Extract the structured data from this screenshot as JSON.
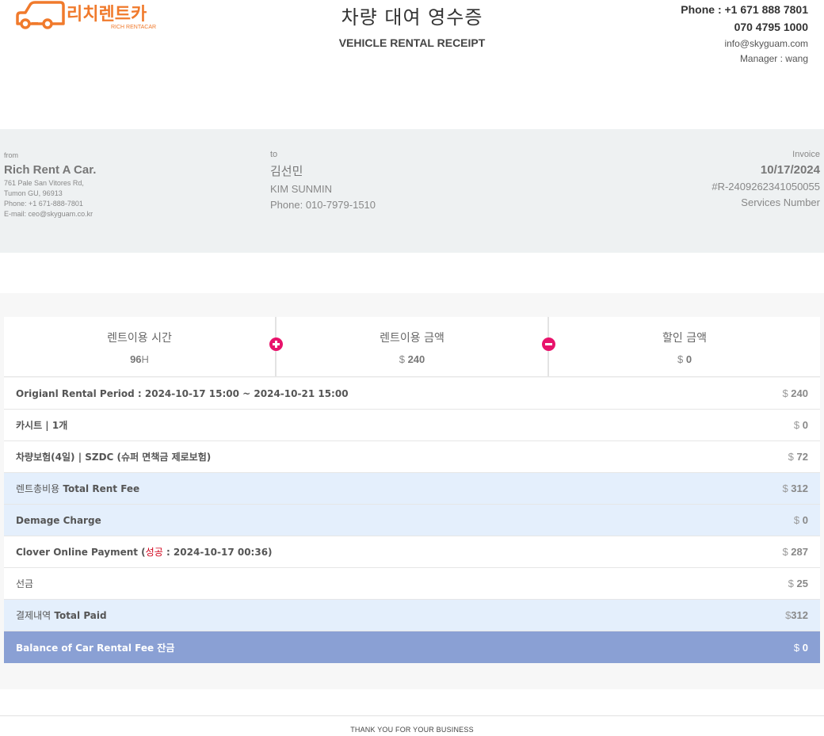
{
  "header": {
    "logo_text_kr": "리치렌트카",
    "logo_text_en": "RICH RENTACAR",
    "title_ko": "차량 대여 영수증",
    "title_en": "VEHICLE RENTAL RECEIPT",
    "phone1": "Phone : +1 671 888 7801",
    "phone2": "070 4795 1000",
    "email": "info@skyguam.com",
    "manager": "Manager : wang",
    "brand_color": "#f07a2c"
  },
  "from": {
    "label": "from",
    "name": "Rich Rent A Car.",
    "address1": "761 Pale San Vitores Rd,",
    "address2": "Tumon GU, 96913",
    "phone": "Phone: +1 671-888-7801",
    "email": "E-mail: ceo@skyguam.co.kr"
  },
  "to": {
    "label": "to",
    "name_kr": "김선민",
    "name_en": "KIM SUNMIN",
    "phone": "Phone: 010-7979-1510"
  },
  "invoice": {
    "label": "Invoice",
    "date": "10/17/2024",
    "number": "#R-2409262341050055",
    "services": "Services Number"
  },
  "summary": {
    "period_label": "렌트이용 시간",
    "period_value": "96",
    "period_unit": "H",
    "amount_label": "렌트이용 금액",
    "amount_currency": "$",
    "amount_value": "240",
    "discount_label": "할인 금액",
    "discount_currency": "$",
    "discount_value": "0",
    "accent_color": "#e8136b"
  },
  "items": [
    {
      "desc": "Origianl Rental Period : 2024-10-17 15:00 ~ 2024-10-21 15:00",
      "currency": "$",
      "amount": "240"
    },
    {
      "desc": "카시트 | 1개",
      "currency": "$",
      "amount": "0"
    },
    {
      "desc": "차량보험(4일) | SZDC (슈퍼 면책금 제로보험)",
      "currency": "$",
      "amount": "72"
    },
    {
      "desc_kr": "렌트총비용",
      "desc": "Total Rent Fee",
      "currency": "$",
      "amount": "312"
    },
    {
      "desc": "Demage Charge",
      "currency": "$",
      "amount": "0"
    },
    {
      "desc_pre": "Clover Online Payment (",
      "desc_status": "성공",
      "desc_post": " : 2024-10-17 00:36)",
      "currency": "$",
      "amount": "287"
    },
    {
      "desc_kr": "선금",
      "currency": "$",
      "amount": "25"
    },
    {
      "desc_kr": "결제내역",
      "desc": "Total Paid",
      "currency": "$",
      "amount": "312"
    },
    {
      "desc_pre": "Balance of Car Rental Fee ",
      "desc_kr": "잔금",
      "currency": "$",
      "amount": "0"
    }
  ],
  "footer": "THANK YOU FOR YOUR BUSINESS"
}
